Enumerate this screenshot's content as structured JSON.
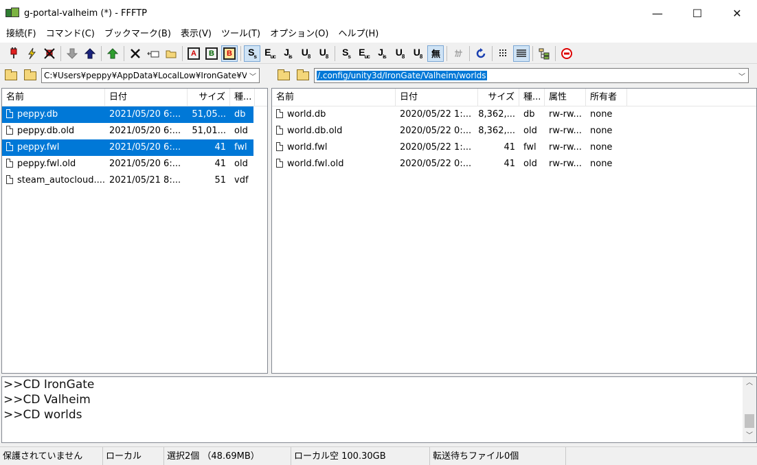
{
  "window": {
    "title": "g-portal-valheim (*) - FFFTP",
    "minimize": "—",
    "maximize": "☐",
    "close": "✕"
  },
  "menu": [
    "接続(F)",
    "コマンド(C)",
    "ブックマーク(B)",
    "表示(V)",
    "ツール(T)",
    "オプション(O)",
    "ヘルプ(H)"
  ],
  "toolbar": {
    "ascii": "A",
    "binary": "B",
    "auto": "B",
    "sjis": "S",
    "euc": "E",
    "jis": "J",
    "utf8n": "U",
    "utf8bom": "U",
    "none": "無",
    "kana": "ｶﾅ"
  },
  "local": {
    "path": "C:¥Users¥peppy¥AppData¥LocalLow¥IronGate¥Valheim¥worlds",
    "columns": [
      "名前",
      "日付",
      "サイズ",
      "種..."
    ],
    "files": [
      {
        "name": "peppy.db",
        "date": "2021/05/20  6:...",
        "size": "51,05...",
        "type": "db",
        "selected": true
      },
      {
        "name": "peppy.db.old",
        "date": "2021/05/20  6:...",
        "size": "51,01...",
        "type": "old",
        "selected": false
      },
      {
        "name": "peppy.fwl",
        "date": "2021/05/20  6:...",
        "size": "41",
        "type": "fwl",
        "selected": true
      },
      {
        "name": "peppy.fwl.old",
        "date": "2021/05/20  6:...",
        "size": "41",
        "type": "old",
        "selected": false
      },
      {
        "name": "steam_autocloud....",
        "date": "2021/05/21  8:...",
        "size": "51",
        "type": "vdf",
        "selected": false
      }
    ]
  },
  "remote": {
    "path": "/.config/unity3d/IronGate/Valheim/worlds",
    "columns": [
      "名前",
      "日付",
      "サイズ",
      "種...",
      "属性",
      "所有者"
    ],
    "files": [
      {
        "name": "world.db",
        "date": "2020/05/22  1:...",
        "size": "8,362,...",
        "type": "db",
        "attr": "rw-rw...",
        "owner": "none"
      },
      {
        "name": "world.db.old",
        "date": "2020/05/22  0:...",
        "size": "8,362,...",
        "type": "old",
        "attr": "rw-rw...",
        "owner": "none"
      },
      {
        "name": "world.fwl",
        "date": "2020/05/22  1:...",
        "size": "41",
        "type": "fwl",
        "attr": "rw-rw...",
        "owner": "none"
      },
      {
        "name": "world.fwl.old",
        "date": "2020/05/22  0:...",
        "size": "41",
        "type": "old",
        "attr": "rw-rw...",
        "owner": "none"
      }
    ]
  },
  "log": [
    ">>CD IronGate",
    ">>CD Valheim",
    ">>CD worlds"
  ],
  "status": {
    "security": "保護されていません",
    "mode": "ローカル",
    "selection": "選択2個 （48.69MB）",
    "local_free": "ローカル空 100.30GB",
    "queue": "転送待ちファイル0個"
  },
  "colors": {
    "selection": "#0078d7",
    "accent": "#0078d7"
  }
}
